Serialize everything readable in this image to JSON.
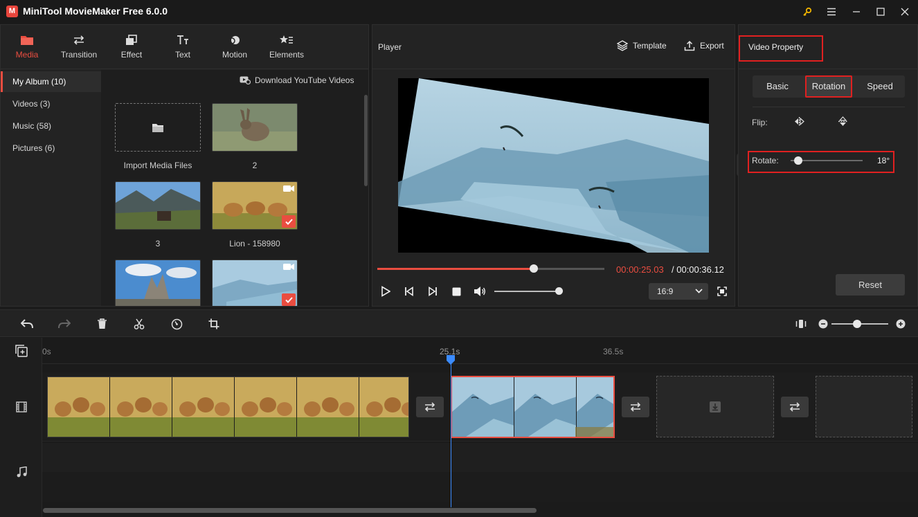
{
  "app": {
    "title": "MiniTool MovieMaker Free 6.0.0",
    "logo_letter": "M"
  },
  "media_tools": [
    {
      "label": "Media",
      "icon": "folder-icon",
      "active": true
    },
    {
      "label": "Transition",
      "icon": "transition-arrows-icon"
    },
    {
      "label": "Effect",
      "icon": "effect-icon"
    },
    {
      "label": "Text",
      "icon": "text-icon"
    },
    {
      "label": "Motion",
      "icon": "motion-icon"
    },
    {
      "label": "Elements",
      "icon": "elements-icon"
    }
  ],
  "sidebar": {
    "items": [
      {
        "label": "My Album (10)",
        "active": true
      },
      {
        "label": "Videos (3)"
      },
      {
        "label": "Music (58)"
      },
      {
        "label": "Pictures (6)"
      }
    ]
  },
  "media": {
    "download_label": "Download YouTube Videos",
    "import_label": "Import Media Files",
    "items": [
      {
        "label": "2"
      },
      {
        "label": "3"
      },
      {
        "label": "Lion - 158980"
      }
    ]
  },
  "player": {
    "title": "Player",
    "template_label": "Template",
    "export_label": "Export",
    "time_current": "00:00:25.03",
    "time_separator": " / ",
    "time_total": "00:00:36.12",
    "aspect_ratio": "16:9",
    "progress_fraction": 0.69
  },
  "property": {
    "title": "Video Property",
    "tabs": [
      {
        "label": "Basic"
      },
      {
        "label": "Rotation",
        "active": true
      },
      {
        "label": "Speed"
      }
    ],
    "flip_label": "Flip:",
    "rotate_label": "Rotate:",
    "rotate_value": "18°",
    "reset_label": "Reset"
  },
  "timeline": {
    "ruler": [
      "0s",
      "25.1s",
      "36.5s"
    ]
  },
  "colors": {
    "accent": "#ea4d40",
    "highlight_box": "#e12020",
    "playhead": "#3b8bff"
  }
}
